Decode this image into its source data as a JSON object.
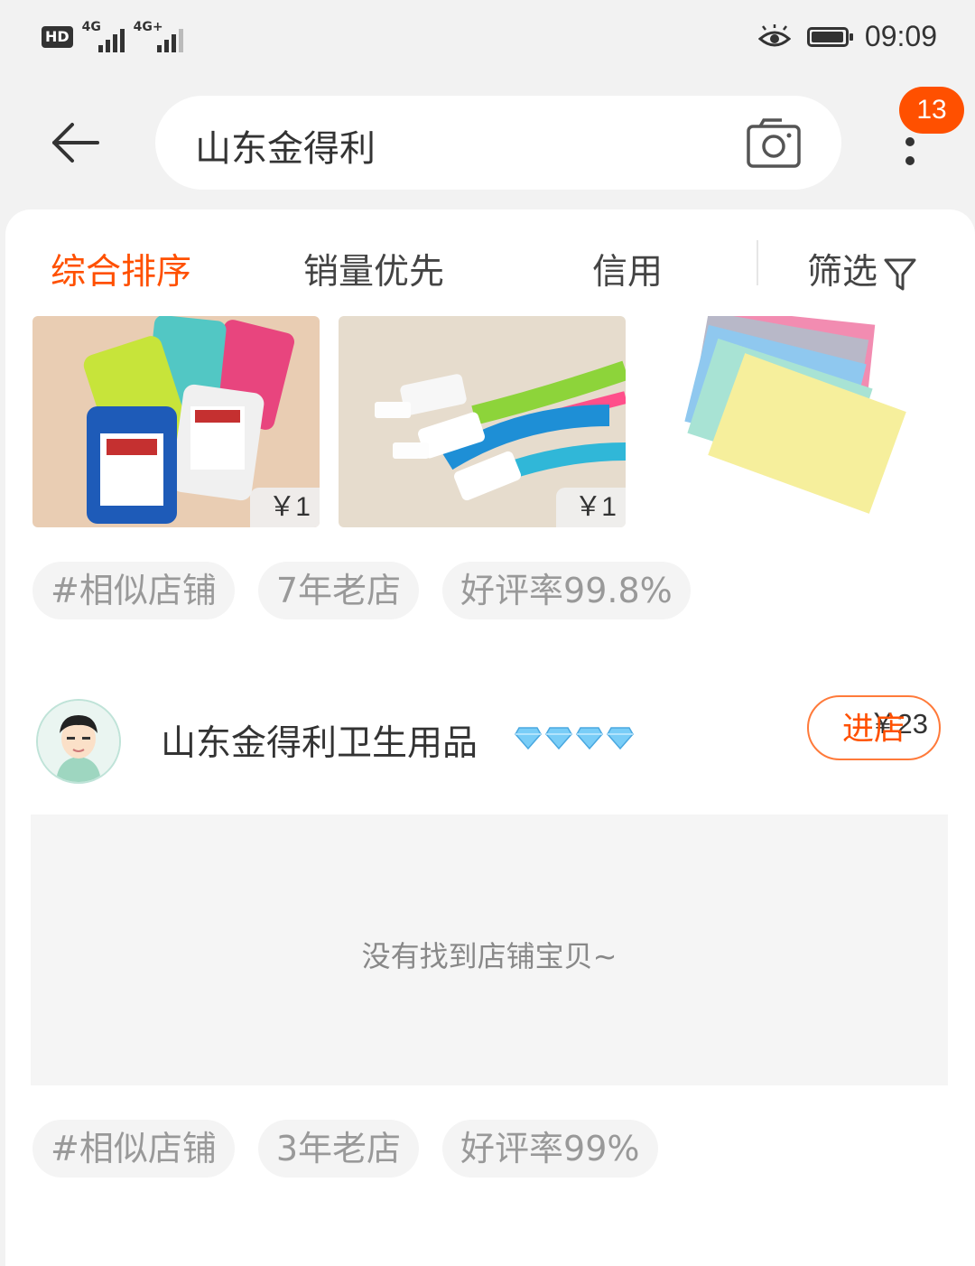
{
  "status_bar": {
    "hd": "HD",
    "net1": "4G",
    "net2": "4G+",
    "time": "09:09",
    "icons": [
      "eye-comfort-icon",
      "battery-icon"
    ]
  },
  "header": {
    "search_value": "山东金得利",
    "badge_count": "13",
    "icons": [
      "back-arrow-icon",
      "camera-icon",
      "more-dots-icon"
    ]
  },
  "sort_bar": {
    "items": [
      "综合排序",
      "销量优先",
      "信用",
      "筛选"
    ],
    "active_index": 0
  },
  "shop1": {
    "products": [
      {
        "price": "￥1",
        "image": "id-card-holders"
      },
      {
        "price": "￥1",
        "image": "lanyards"
      },
      {
        "price": "￥23",
        "image": "pouches"
      }
    ],
    "tags": [
      "#相似店铺",
      "7年老店",
      "好评率99.8%"
    ]
  },
  "shop2": {
    "name": "山东金得利卫生用品",
    "diamond_count": 4,
    "enter_label": "进店",
    "empty_text": "没有找到店铺宝贝~",
    "tags": [
      "#相似店铺",
      "3年老店",
      "好评率99%"
    ]
  },
  "colors": {
    "accent": "#ff5000",
    "background": "#f2f2f2",
    "card": "#ffffff",
    "tag_bg": "#f4f4f4",
    "muted_text": "#999999"
  }
}
